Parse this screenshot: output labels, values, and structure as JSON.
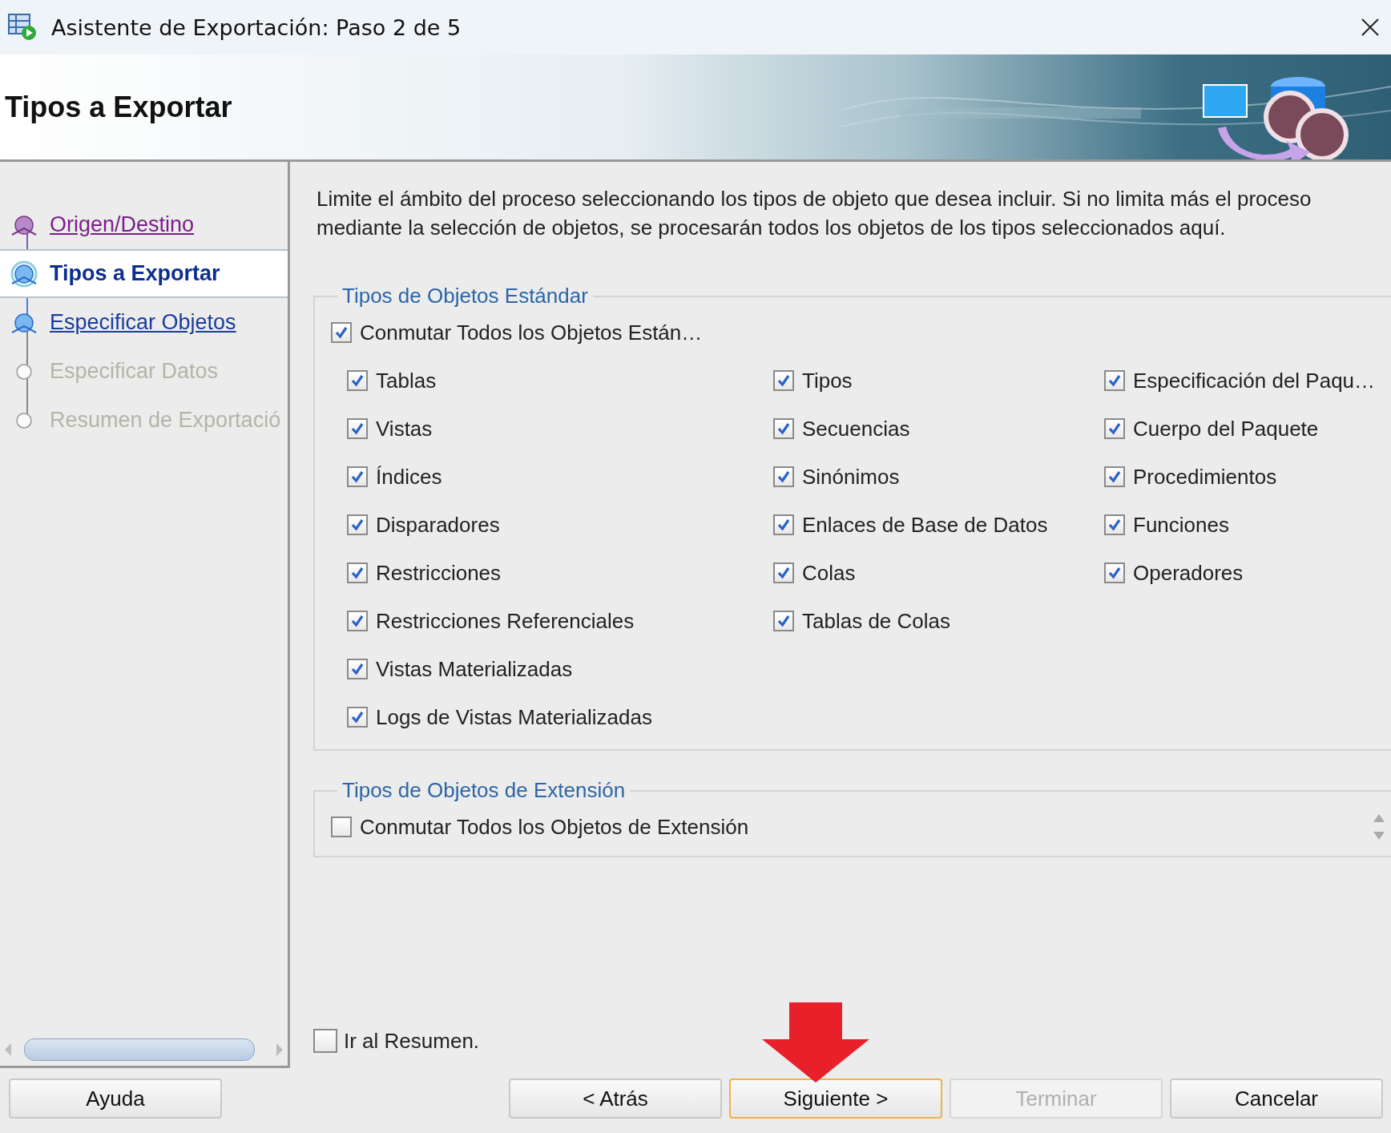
{
  "window": {
    "title": "Asistente de Exportación: Paso 2 de 5"
  },
  "header": {
    "title": "Tipos a Exportar"
  },
  "steps": [
    {
      "label": "Origen/Destino",
      "kind": "visited",
      "selected": false
    },
    {
      "label": "Tipos a Exportar",
      "kind": "current",
      "selected": true
    },
    {
      "label": "Especificar Objetos",
      "kind": "link",
      "selected": false
    },
    {
      "label": "Especificar Datos",
      "kind": "disabled",
      "selected": false
    },
    {
      "label": "Resumen de Exportació",
      "kind": "disabled",
      "selected": false
    }
  ],
  "description": "Limite el ámbito del proceso seleccionando los tipos de objeto que desea incluir. Si no limita más el proceso mediante la selección de objetos, se procesarán todos los objetos de los tipos seleccionados aquí.",
  "groups": [
    {
      "title": "Tipos de Objetos Estándar",
      "toggle": {
        "label": "Conmutar Todos los Objetos Están…",
        "checked": true
      },
      "columns": [
        [
          {
            "label": "Tablas",
            "checked": true
          },
          {
            "label": "Vistas",
            "checked": true
          },
          {
            "label": "Índices",
            "checked": true
          },
          {
            "label": "Disparadores",
            "checked": true
          },
          {
            "label": "Restricciones",
            "checked": true
          },
          {
            "label": "Restricciones Referenciales",
            "checked": true
          },
          {
            "label": "Vistas Materializadas",
            "checked": true
          },
          {
            "label": "Logs de Vistas Materializadas",
            "checked": true
          }
        ],
        [
          {
            "label": "Tipos",
            "checked": true
          },
          {
            "label": "Secuencias",
            "checked": true
          },
          {
            "label": "Sinónimos",
            "checked": true
          },
          {
            "label": "Enlaces de Base de Datos",
            "checked": true
          },
          {
            "label": "Colas",
            "checked": true
          },
          {
            "label": "Tablas de Colas",
            "checked": true
          }
        ],
        [
          {
            "label": "Especificación del Paqu…",
            "checked": true
          },
          {
            "label": "Cuerpo del Paquete",
            "checked": true
          },
          {
            "label": "Procedimientos",
            "checked": true
          },
          {
            "label": "Funciones",
            "checked": true
          },
          {
            "label": "Operadores",
            "checked": true
          }
        ]
      ]
    },
    {
      "title": "Tipos de Objetos de Extensión",
      "toggle": {
        "label": "Conmutar Todos los Objetos de Extensión",
        "checked": false
      }
    }
  ],
  "go_to_summary": {
    "label": "Ir al Resumen.",
    "checked": false
  },
  "buttons": [
    {
      "label": "Ayuda",
      "disabled": false,
      "focused": false
    },
    {
      "label": "< Atrás",
      "disabled": false,
      "focused": false
    },
    {
      "label": "Siguiente >",
      "disabled": false,
      "focused": true
    },
    {
      "label": "Terminar",
      "disabled": true,
      "focused": false
    },
    {
      "label": "Cancelar",
      "disabled": false,
      "focused": false
    }
  ]
}
